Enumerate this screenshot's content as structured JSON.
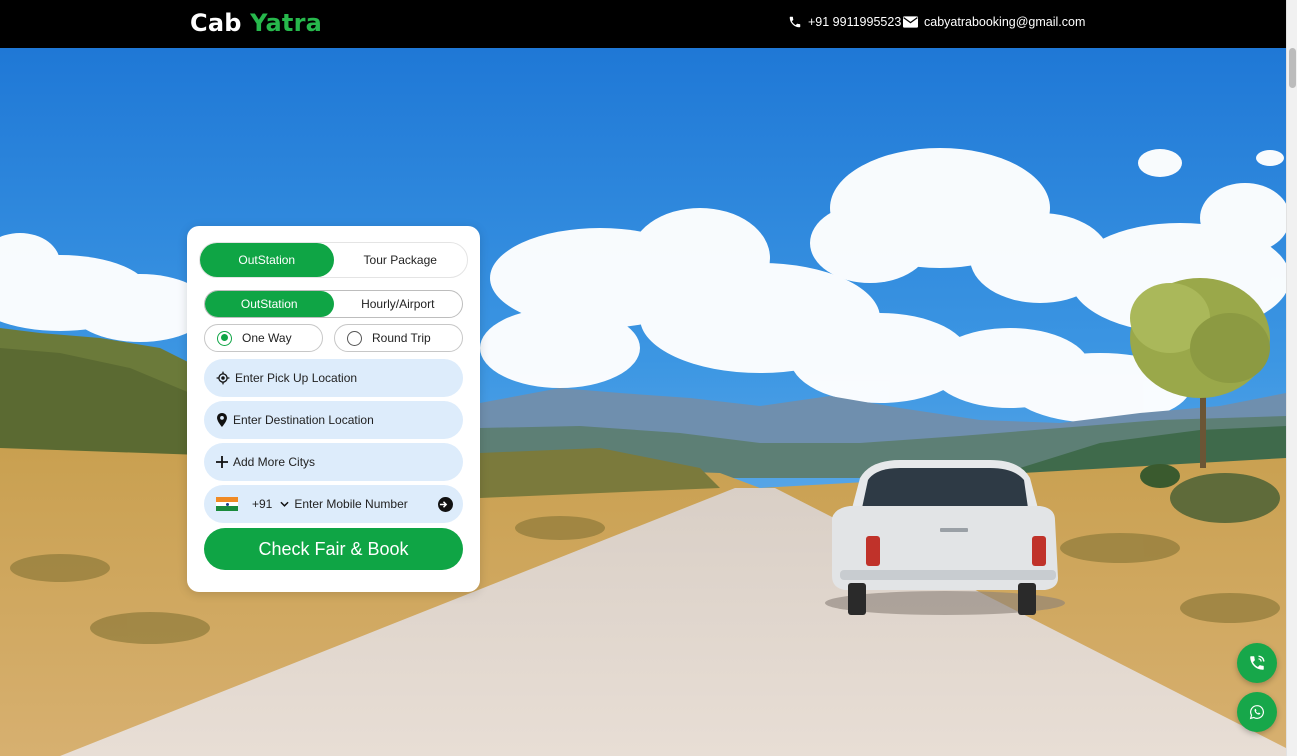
{
  "header": {
    "brand_part1": "Cab",
    "brand_part2": "Yatra",
    "phone": "+91 9911995523",
    "email": "cabyatrabooking@gmail.com"
  },
  "booking": {
    "main_tabs": [
      {
        "label": "OutStation",
        "active": true
      },
      {
        "label": "Tour Package",
        "active": false
      }
    ],
    "sub_tabs": [
      {
        "label": "OutStation",
        "active": true
      },
      {
        "label": "Hourly/Airport",
        "active": false
      }
    ],
    "trip_types": [
      {
        "label": "One Way",
        "checked": true
      },
      {
        "label": "Round Trip",
        "checked": false
      }
    ],
    "pickup_placeholder": "Enter Pick Up Location",
    "destination_placeholder": "Enter Destination Location",
    "add_more_label": "Add More Citys",
    "country_code": "+91",
    "mobile_placeholder": "Enter Mobile Number",
    "submit_label": "Check Fair & Book"
  },
  "floating_buttons": [
    {
      "name": "call",
      "icon": "phone-call-icon"
    },
    {
      "name": "whatsapp",
      "icon": "whatsapp-icon"
    }
  ],
  "colors": {
    "accent": "#0fa545",
    "brand_green": "#27b84c",
    "field_bg": "#ddecfb",
    "header_bg": "#000000"
  }
}
